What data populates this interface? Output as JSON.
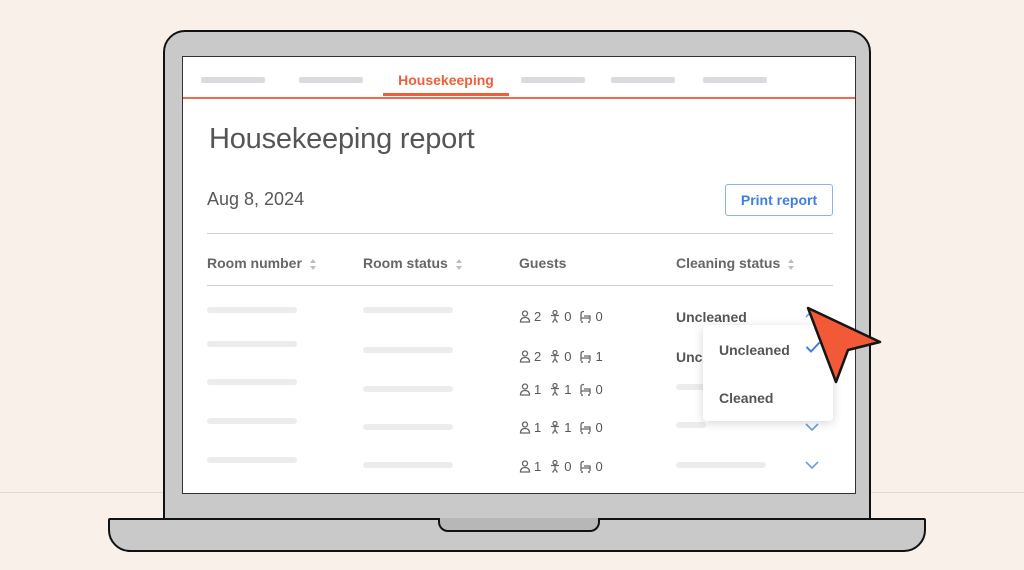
{
  "nav": {
    "active_tab": "Housekeeping",
    "accent_color": "#ef5f3c"
  },
  "page": {
    "title": "Housekeeping report",
    "date": "Aug 8, 2024",
    "print_button": "Print report"
  },
  "table": {
    "headers": {
      "room_number": "Room number",
      "room_status": "Room status",
      "guests": "Guests",
      "cleaning_status": "Cleaning status"
    },
    "rows": [
      {
        "adults": "2",
        "children": "0",
        "infants": "0",
        "cleaning_status": "Uncleaned"
      },
      {
        "adults": "2",
        "children": "0",
        "infants": "1",
        "cleaning_status": "Uncle"
      },
      {
        "adults": "1",
        "children": "1",
        "infants": "0",
        "cleaning_status": ""
      },
      {
        "adults": "1",
        "children": "1",
        "infants": "0",
        "cleaning_status": ""
      },
      {
        "adults": "1",
        "children": "0",
        "infants": "0",
        "cleaning_status": ""
      }
    ]
  },
  "dropdown": {
    "options": [
      "Uncleaned",
      "Cleaned"
    ],
    "selected": "Uncleaned",
    "check_color": "#3d7fe0"
  },
  "icons": {
    "adult": "adult-icon",
    "child": "child-icon",
    "infant": "infant-icon",
    "sort": "sort-icon",
    "chevron": "chevron-down-icon",
    "check": "check-icon",
    "cursor": "cursor-arrow-icon"
  }
}
